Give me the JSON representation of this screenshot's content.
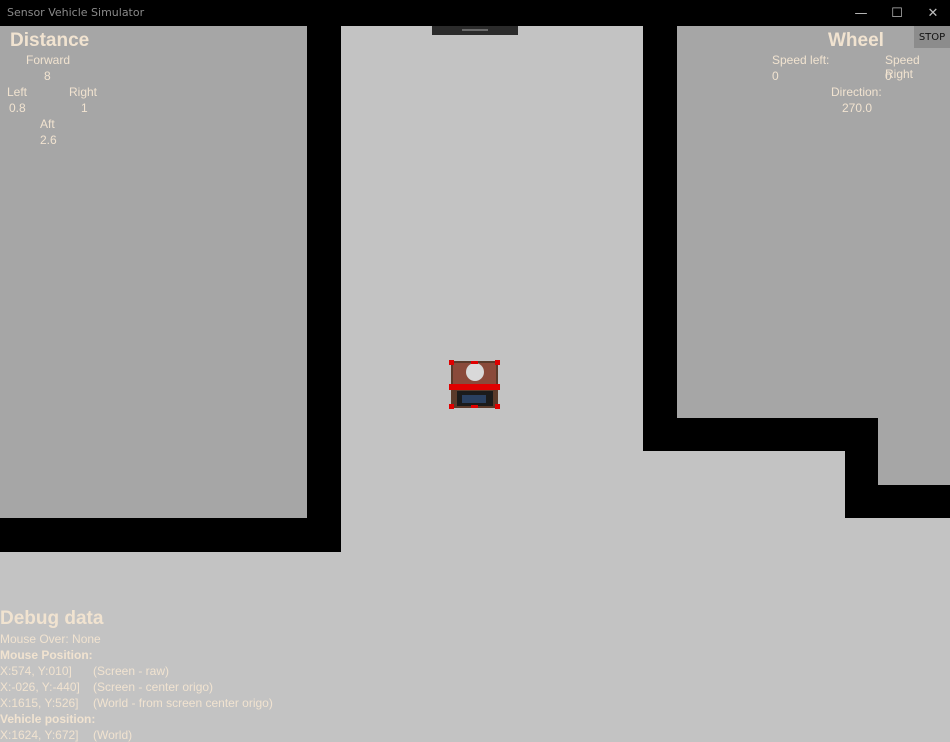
{
  "window": {
    "title": "Sensor Vehicle Simulator"
  },
  "controls": {
    "minimize": "—",
    "maximize": "☐",
    "close": "✕"
  },
  "stop_label": "STOP",
  "distance": {
    "title": "Distance",
    "forward_label": "Forward",
    "forward_value": "8",
    "left_label": "Left",
    "left_value": "0.8",
    "right_label": "Right",
    "right_value": "1",
    "aft_label": "Aft",
    "aft_value": "2.6"
  },
  "wheel": {
    "title": "Wheel",
    "speed_left_label": "Speed left:",
    "speed_left_value": "0",
    "speed_right_label": "Speed Right",
    "speed_right_value": "0",
    "direction_label": "Direction:",
    "direction_value": "270.0"
  },
  "debug": {
    "title": "Debug data",
    "mouse_over": "Mouse Over: None",
    "mouse_position_label": "Mouse Position:",
    "screen_raw_value": "X:574, Y:010]",
    "screen_raw_desc": "(Screen - raw)",
    "screen_center_value": "X:-026, Y:-440]",
    "screen_center_desc": "(Screen - center origo)",
    "world_mouse_value": "X:1615, Y:526]",
    "world_mouse_desc": "(World - from screen center origo)",
    "vehicle_position_label": "Vehicle position:",
    "vehicle_value": "X:1624, Y:672]",
    "vehicle_desc": "(World)"
  },
  "colors": {
    "floor": "#c3c3c3",
    "room": "#a6a6a6",
    "wall": "#000000",
    "label": "#f1e3d0"
  }
}
